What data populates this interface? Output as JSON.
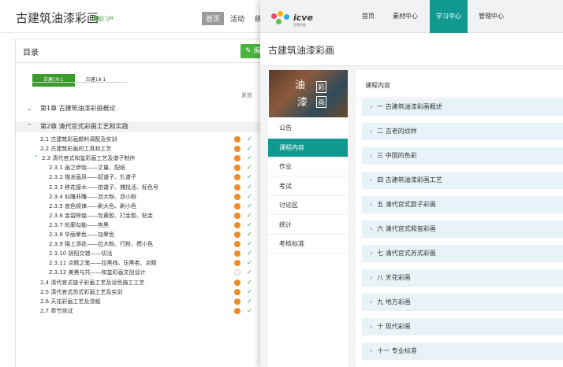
{
  "left": {
    "course_title": "古建筑油漆彩画",
    "course_sub": "课程门户",
    "nav": {
      "home": "首页",
      "activity": "活动",
      "more": "统"
    },
    "toc_title": "目录",
    "edit_label": "编",
    "tabs": [
      "古建19-1",
      "古建18-1"
    ],
    "col_head": "发放",
    "rows": [
      {
        "text": "第1章 古建筑油漆彩画概论",
        "type": "chapter",
        "chev": "⌄",
        "bg": false,
        "status": false
      },
      {
        "text": "第2章 清代官式彩画工艺和实践",
        "type": "chapter",
        "chev": "⌃",
        "bg": true,
        "status": false
      },
      {
        "text": "2.1 古建筑彩画颜料调配及实训",
        "type": "section",
        "status": true
      },
      {
        "text": "2.2 古建筑彩画的工具和工艺",
        "type": "section",
        "status": true
      },
      {
        "text": "2.3 清代官式和玺彩画工艺及谱子制作",
        "type": "section-open",
        "status": true
      },
      {
        "text": "2.3.1 画之伊始——丈量、配纸",
        "type": "sub",
        "status": true
      },
      {
        "text": "2.3.2 描龙画凤——起谱子、扎谱子",
        "type": "sub",
        "status": true
      },
      {
        "text": "2.3.3 移花接木——拍谱子、摊找活、标色号",
        "type": "sub",
        "status": true
      },
      {
        "text": "2.3.4 似雕非雕——沥大粉、沥小粉",
        "type": "sub",
        "status": true
      },
      {
        "text": "2.3.5 底色规律——刷大色、刷小色",
        "type": "sub",
        "status": true
      },
      {
        "text": "2.3.6 金碧辉煌——包黄胶、打金胶、贴金",
        "type": "sub",
        "status": true
      },
      {
        "text": "2.3.7 轮廓勾勒——拘黑",
        "type": "sub",
        "status": true
      },
      {
        "text": "2.3.8 华丽晕色——加晕色",
        "type": "sub",
        "status": true
      },
      {
        "text": "2.3.9 锦上添花——拉大粉、行粉、攒小色",
        "type": "sub",
        "status": true
      },
      {
        "text": "2.3.10 阴阳交错——切活",
        "type": "sub",
        "status": true
      },
      {
        "text": "2.3.11 点睛之笔——拉黑线、压黑老、点睛",
        "type": "sub",
        "status": true
      },
      {
        "text": "2.3.12 美美与共——和玺彩画文创设计",
        "type": "sub",
        "status": true,
        "hollow": true
      },
      {
        "text": "2.4 清代官式旋子彩画工艺及设色施工工艺",
        "type": "section",
        "status": true
      },
      {
        "text": "2.5 清代官式苏式彩画工艺及实训",
        "type": "section",
        "status": true
      },
      {
        "text": "2.6 天花彩画工艺及流程",
        "type": "section",
        "status": true
      },
      {
        "text": "2.7 章节测试",
        "type": "section",
        "status": true
      }
    ]
  },
  "right": {
    "logo_text": "icve",
    "logo_sub": "智慧职教",
    "nav": [
      "首页",
      "素材中心",
      "学习中心",
      "管理中心"
    ],
    "nav_active": 2,
    "title": "古建筑油漆彩画",
    "cover": {
      "c1": "油",
      "c2": "彩",
      "c3": "漆",
      "c4": "画"
    },
    "side": [
      "公告",
      "课程内容",
      "作业",
      "考试",
      "讨论区",
      "统计",
      "考核标准"
    ],
    "side_active": 1,
    "content_title": "课程内容",
    "units": [
      "一 古建筑油漆彩画概述",
      "二 古老的纹样",
      "三 中国的色彩",
      "四 古建筑油漆彩画工艺",
      "五 清代官式旋子彩画",
      "六 清代官式和玺彩画",
      "七 清代官式苏式彩画",
      "八 天花彩画",
      "九 地方彩画",
      "十 现代彩画",
      "十一 专业标准"
    ],
    "accent": "#109a8f"
  }
}
